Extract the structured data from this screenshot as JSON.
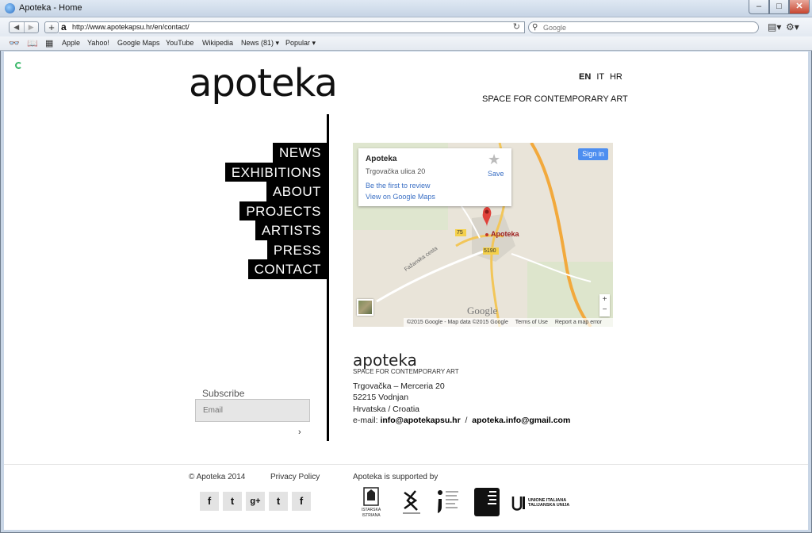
{
  "browser": {
    "window_title": "Apoteka - Home",
    "url": "http://www.apotekapsu.hr/en/contact/",
    "search_placeholder": "Google",
    "bookmarks": [
      "Apple",
      "Yahoo!",
      "Google Maps",
      "YouTube",
      "Wikipedia",
      "News (81)",
      "Popular"
    ]
  },
  "header": {
    "logo": "apoteka",
    "languages": [
      "EN",
      "IT",
      "HR"
    ],
    "active_language": "EN",
    "tagline": "SPACE FOR CONTEMPORARY ART"
  },
  "menu": [
    "NEWS",
    "EXHIBITIONS",
    "ABOUT",
    "PROJECTS",
    "ARTISTS",
    "PRESS",
    "CONTACT"
  ],
  "map": {
    "place_name": "Apoteka",
    "place_address": "Trgovačka ulica 20",
    "review_link": "Be the first to review",
    "maps_link": "View on Google Maps",
    "save_label": "Save",
    "signin_label": "Sign in",
    "pin_label": "Apoteka",
    "road_75": "75",
    "road_5190": "5190",
    "street_name": "Fažanska cesta",
    "watermark": "Google",
    "footer_copyright": "©2015 Google - Map data ©2015 Google",
    "footer_terms": "Terms of Use",
    "footer_report": "Report a map error",
    "zoom_in": "+",
    "zoom_out": "−"
  },
  "contact": {
    "title": "apoteka",
    "subtitle": "SPACE FOR CONTEMPORARY ART",
    "street": "Trgovačka – Merceria 20",
    "city": "52215 Vodnjan",
    "country": "Hrvatska / Croatia",
    "email_prefix": "e-mail:",
    "email_1": "info@apotekapsu.hr",
    "email_separator": "/",
    "email_2": "apoteka.info@gmail.com"
  },
  "subscribe": {
    "label": "Subscribe",
    "placeholder": "Email",
    "submit": "›"
  },
  "footer": {
    "copyright": "© Apoteka 2014",
    "privacy": "Privacy Policy",
    "supported_by": "Apoteka is supported by",
    "social_icons": [
      "facebook-icon",
      "twitter-icon",
      "google-plus-icon",
      "tumblr-icon",
      "foursquare-icon"
    ],
    "social_glyphs": [
      "f",
      "t",
      "g+",
      "t",
      "f"
    ],
    "sponsor_1_text": "ISTARSKA ISTRIANA",
    "sponsor_5_text": "UNIONE ITALIANA TALIJANSKA UNIJA"
  },
  "colors": {
    "text": "#111111",
    "link": "#3a6fc4",
    "menu_bg": "#000000",
    "map_road": "#f2b43c",
    "pin": "#e0413a"
  }
}
